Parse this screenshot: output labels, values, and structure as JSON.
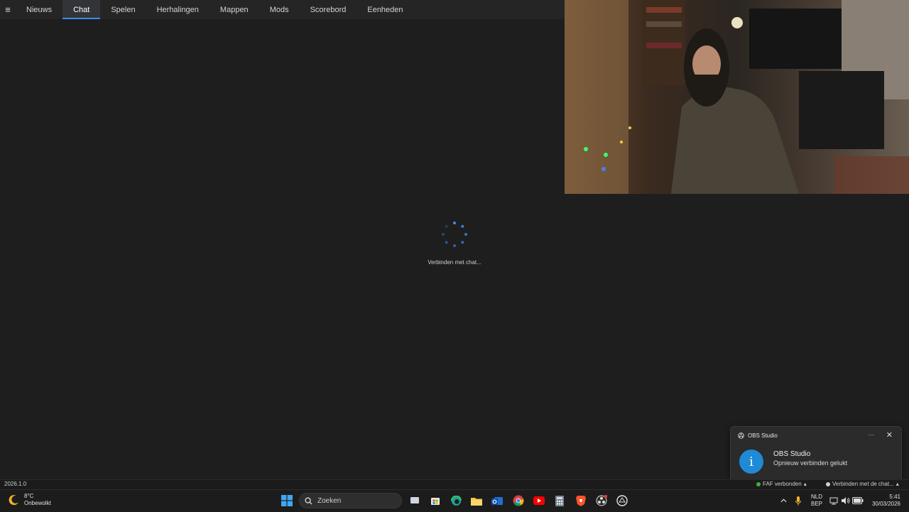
{
  "nav": {
    "menu_icon": "hamburger-icon",
    "tabs": [
      {
        "label": "Nieuws",
        "active": false
      },
      {
        "label": "Chat",
        "active": true
      },
      {
        "label": "Spelen",
        "active": false
      },
      {
        "label": "Herhalingen",
        "active": false
      },
      {
        "label": "Mappen",
        "active": false
      },
      {
        "label": "Mods",
        "active": false
      },
      {
        "label": "Scorebord",
        "active": false
      },
      {
        "label": "Eenheden",
        "active": false
      }
    ]
  },
  "chat": {
    "loading_text": "Verbinden met chat..."
  },
  "status_bar": {
    "version": "2026.1.0",
    "faf_status": "FAF verbonden",
    "faf_color": "#3cb043",
    "chat_status": "Verbinden met de chat...",
    "chat_color": "#d0d0d0"
  },
  "notification": {
    "app": "OBS Studio",
    "title": "OBS Studio",
    "message": "Opnieuw verbinden gelukt",
    "icon": "info-icon",
    "accent": "#1f8ad6"
  },
  "taskbar": {
    "weather_temp": "8°C",
    "weather_desc": "Onbewolkt",
    "search_label": "Zoeken",
    "lang": "NLD",
    "layout": "BEP",
    "time": "5:41",
    "date": "30/03/2026"
  }
}
